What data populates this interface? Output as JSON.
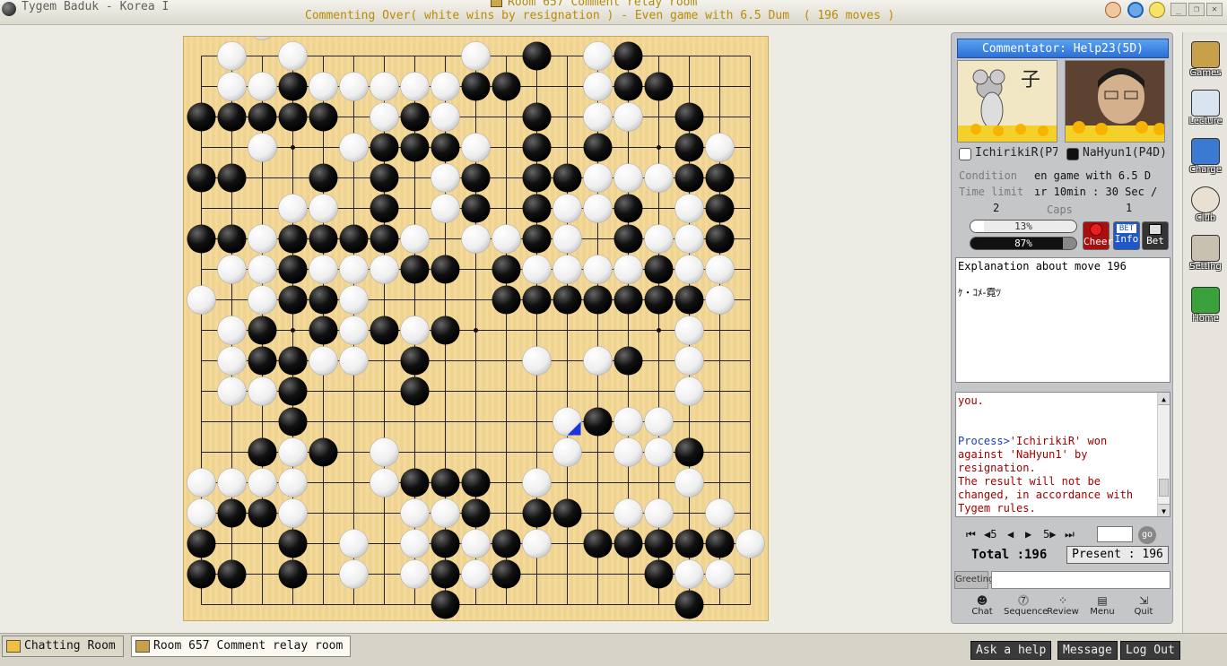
{
  "window": {
    "app_title": "Tygem Baduk - Korea I",
    "room_title": "Room 657 Comment relay room",
    "game_status": "Commenting Over( white wins by resignation ) - Even game with 6.5 Dum  ( 196 moves )"
  },
  "panel": {
    "commentator": "Commentator: Help23(5D)",
    "white_player": "IchirikiR(P7",
    "black_player": "NaHyun1(P4D)",
    "condition_label": "Condition",
    "condition_value": "en game with 6.5 D",
    "time_label": "Time limit",
    "time_value": "ır 10min : 30 Sec /",
    "caps_label": "Caps",
    "caps_white": "2",
    "caps_black": "1",
    "gauge_white": "13%",
    "gauge_black": "87%",
    "gauge_white_fraction": 0.13,
    "gauge_black_fraction": 0.87,
    "cheer_label": "Cheer",
    "info_label": "Info",
    "bet_label": "Bet",
    "bet_tag": "BET"
  },
  "explanation": {
    "title": "Explanation about move 196",
    "text": "ｹ・ｺﾒ-霓ﾂ"
  },
  "chat": {
    "line1": "you.",
    "process_prefix": "Process>",
    "line2": "'IchirikiR' won against 'NaHyun1' by resignation.",
    "line3": "The result will not be changed, in accordance with Tygem rules."
  },
  "navigation": {
    "first": "⏮",
    "back5": "◀5",
    "back": "◀",
    "forward": "▶",
    "forward5": "5▶",
    "last": "⏭",
    "go": "go",
    "total_label": "Total :196",
    "present_label": "Present : 196"
  },
  "greeting": {
    "label": "Greeting",
    "value": ""
  },
  "tools": [
    "Chat",
    "Sequence",
    "Review",
    "Menu",
    "Quit"
  ],
  "sidebar": [
    "Games",
    "Lecture",
    "Charge",
    "Club",
    "Setting",
    "Home"
  ],
  "tabs": {
    "chatting": "Chatting Room",
    "room": "Room 657 Comment relay room"
  },
  "bottom_buttons": [
    "Ask a help",
    "Message",
    "Log Out"
  ],
  "colors": {
    "board": "#f4d794",
    "commentator_bar": "#2d6fd6",
    "process_text": "#1a3ccf",
    "chat_text": "#a00000"
  },
  "board": {
    "size": 19,
    "stars": [
      [
        3,
        3
      ],
      [
        3,
        9
      ],
      [
        3,
        15
      ],
      [
        9,
        3
      ],
      [
        9,
        9
      ],
      [
        9,
        15
      ],
      [
        15,
        3
      ],
      [
        15,
        9
      ],
      [
        15,
        15
      ]
    ],
    "last_move": [
      12,
      12
    ],
    "black": [
      [
        0,
        11
      ],
      [
        0,
        14
      ],
      [
        1,
        3
      ],
      [
        1,
        9
      ],
      [
        1,
        10
      ],
      [
        1,
        14
      ],
      [
        1,
        15
      ],
      [
        2,
        0
      ],
      [
        2,
        1
      ],
      [
        2,
        2
      ],
      [
        2,
        3
      ],
      [
        2,
        4
      ],
      [
        2,
        7
      ],
      [
        2,
        11
      ],
      [
        2,
        16
      ],
      [
        3,
        6
      ],
      [
        3,
        7
      ],
      [
        3,
        8
      ],
      [
        3,
        11
      ],
      [
        3,
        13
      ],
      [
        3,
        16
      ],
      [
        4,
        0
      ],
      [
        4,
        1
      ],
      [
        4,
        4
      ],
      [
        4,
        6
      ],
      [
        4,
        9
      ],
      [
        4,
        11
      ],
      [
        4,
        12
      ],
      [
        4,
        16
      ],
      [
        4,
        17
      ],
      [
        5,
        6
      ],
      [
        5,
        9
      ],
      [
        5,
        11
      ],
      [
        5,
        14
      ],
      [
        5,
        17
      ],
      [
        6,
        0
      ],
      [
        6,
        1
      ],
      [
        6,
        3
      ],
      [
        6,
        4
      ],
      [
        6,
        5
      ],
      [
        6,
        6
      ],
      [
        6,
        11
      ],
      [
        6,
        14
      ],
      [
        6,
        17
      ],
      [
        7,
        3
      ],
      [
        7,
        7
      ],
      [
        7,
        8
      ],
      [
        7,
        10
      ],
      [
        7,
        15
      ],
      [
        8,
        3
      ],
      [
        8,
        4
      ],
      [
        8,
        10
      ],
      [
        8,
        11
      ],
      [
        8,
        12
      ],
      [
        8,
        13
      ],
      [
        8,
        14
      ],
      [
        8,
        15
      ],
      [
        8,
        16
      ],
      [
        9,
        2
      ],
      [
        9,
        4
      ],
      [
        9,
        6
      ],
      [
        9,
        8
      ],
      [
        10,
        2
      ],
      [
        10,
        3
      ],
      [
        10,
        7
      ],
      [
        10,
        14
      ],
      [
        11,
        2
      ],
      [
        11,
        3
      ],
      [
        11,
        7
      ],
      [
        12,
        3
      ],
      [
        12,
        13
      ],
      [
        12,
        15
      ],
      [
        13,
        2
      ],
      [
        13,
        4
      ],
      [
        13,
        16
      ],
      [
        14,
        7
      ],
      [
        14,
        8
      ],
      [
        14,
        9
      ],
      [
        15,
        1
      ],
      [
        15,
        2
      ],
      [
        15,
        9
      ],
      [
        15,
        11
      ],
      [
        15,
        12
      ],
      [
        16,
        0
      ],
      [
        16,
        3
      ],
      [
        16,
        8
      ],
      [
        16,
        10
      ],
      [
        16,
        13
      ],
      [
        16,
        14
      ],
      [
        16,
        15
      ],
      [
        16,
        16
      ],
      [
        16,
        17
      ],
      [
        17,
        0
      ],
      [
        17,
        1
      ],
      [
        17,
        3
      ],
      [
        17,
        8
      ],
      [
        17,
        10
      ],
      [
        17,
        15
      ],
      [
        18,
        8
      ],
      [
        18,
        16
      ]
    ],
    "white": [
      [
        -1,
        2
      ],
      [
        0,
        1
      ],
      [
        0,
        3
      ],
      [
        0,
        9
      ],
      [
        0,
        13
      ],
      [
        1,
        1
      ],
      [
        1,
        2
      ],
      [
        1,
        4
      ],
      [
        1,
        5
      ],
      [
        1,
        6
      ],
      [
        1,
        7
      ],
      [
        1,
        8
      ],
      [
        1,
        13
      ],
      [
        2,
        6
      ],
      [
        2,
        8
      ],
      [
        2,
        13
      ],
      [
        2,
        14
      ],
      [
        3,
        2
      ],
      [
        3,
        5
      ],
      [
        3,
        9
      ],
      [
        3,
        17
      ],
      [
        4,
        8
      ],
      [
        4,
        13
      ],
      [
        4,
        14
      ],
      [
        4,
        15
      ],
      [
        5,
        3
      ],
      [
        5,
        4
      ],
      [
        5,
        8
      ],
      [
        5,
        12
      ],
      [
        5,
        13
      ],
      [
        5,
        16
      ],
      [
        6,
        2
      ],
      [
        6,
        7
      ],
      [
        6,
        9
      ],
      [
        6,
        10
      ],
      [
        6,
        12
      ],
      [
        6,
        15
      ],
      [
        6,
        16
      ],
      [
        7,
        1
      ],
      [
        7,
        2
      ],
      [
        7,
        4
      ],
      [
        7,
        5
      ],
      [
        7,
        6
      ],
      [
        7,
        11
      ],
      [
        7,
        12
      ],
      [
        7,
        13
      ],
      [
        7,
        14
      ],
      [
        7,
        16
      ],
      [
        7,
        17
      ],
      [
        8,
        0
      ],
      [
        8,
        2
      ],
      [
        8,
        5
      ],
      [
        8,
        17
      ],
      [
        9,
        1
      ],
      [
        9,
        5
      ],
      [
        9,
        7
      ],
      [
        9,
        16
      ],
      [
        10,
        1
      ],
      [
        10,
        4
      ],
      [
        10,
        5
      ],
      [
        10,
        11
      ],
      [
        10,
        13
      ],
      [
        10,
        16
      ],
      [
        11,
        1
      ],
      [
        11,
        2
      ],
      [
        11,
        16
      ],
      [
        12,
        12
      ],
      [
        12,
        14
      ],
      [
        12,
        15
      ],
      [
        13,
        3
      ],
      [
        13,
        6
      ],
      [
        13,
        12
      ],
      [
        13,
        14
      ],
      [
        13,
        15
      ],
      [
        14,
        0
      ],
      [
        14,
        1
      ],
      [
        14,
        2
      ],
      [
        14,
        3
      ],
      [
        14,
        6
      ],
      [
        14,
        11
      ],
      [
        14,
        16
      ],
      [
        15,
        0
      ],
      [
        15,
        3
      ],
      [
        15,
        7
      ],
      [
        15,
        8
      ],
      [
        15,
        14
      ],
      [
        15,
        15
      ],
      [
        15,
        17
      ],
      [
        16,
        5
      ],
      [
        16,
        7
      ],
      [
        16,
        9
      ],
      [
        16,
        11
      ],
      [
        16,
        18
      ],
      [
        17,
        5
      ],
      [
        17,
        7
      ],
      [
        17,
        9
      ],
      [
        17,
        16
      ],
      [
        17,
        17
      ]
    ]
  }
}
